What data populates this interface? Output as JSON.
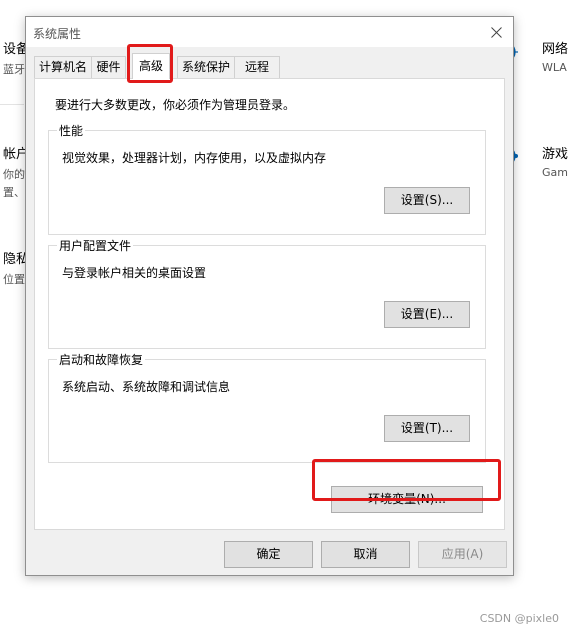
{
  "background": {
    "left_items": [
      {
        "title": "设备",
        "sub": "蓝牙"
      },
      {
        "title": "帐户",
        "sub": "你的",
        "sub2": "置、"
      },
      {
        "title": "隐私",
        "sub": "位置"
      }
    ],
    "right_items": [
      {
        "title": "网络",
        "sub": "WLA",
        "icon": "globe-icon"
      },
      {
        "title": "游戏",
        "sub": "Gam",
        "icon": "xbox-icon"
      }
    ]
  },
  "dialog": {
    "title": "系统属性",
    "tabs": [
      {
        "label": "计算机名"
      },
      {
        "label": "硬件"
      },
      {
        "label": "高级",
        "active": true
      },
      {
        "label": "系统保护"
      },
      {
        "label": "远程"
      }
    ],
    "notice": "要进行大多数更改，你必须作为管理员登录。",
    "groups": {
      "performance": {
        "label": "性能",
        "desc": "视觉效果，处理器计划，内存使用，以及虚拟内存",
        "button": "设置(S)..."
      },
      "user_profiles": {
        "label": "用户配置文件",
        "desc": "与登录帐户相关的桌面设置",
        "button": "设置(E)..."
      },
      "startup_recovery": {
        "label": "启动和故障恢复",
        "desc": "系统启动、系统故障和调试信息",
        "button": "设置(T)..."
      }
    },
    "env_button": "环境变量(N)...",
    "footer": {
      "ok": "确定",
      "cancel": "取消",
      "apply": "应用(A)"
    }
  },
  "watermark": "CSDN @pixle0",
  "colors": {
    "highlight": "#e11a1a",
    "accent": "#0063b1"
  }
}
